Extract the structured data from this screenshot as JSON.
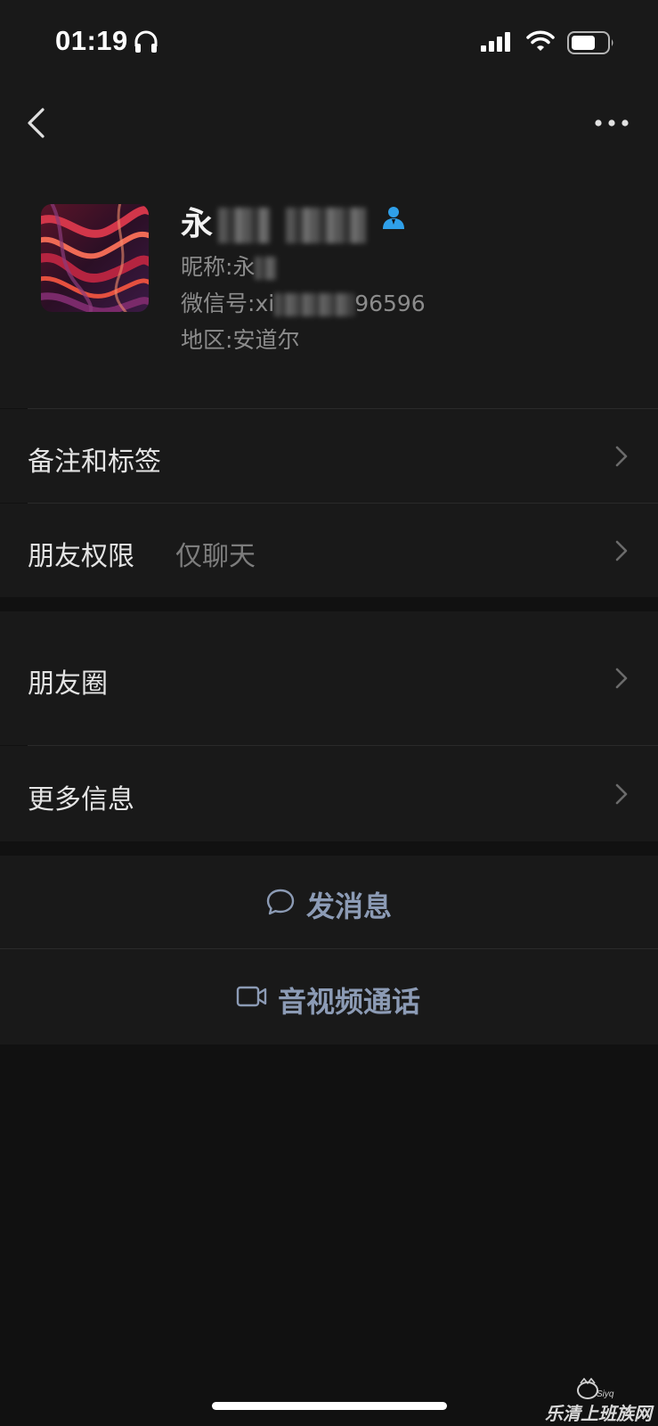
{
  "status_bar": {
    "time": "01:19"
  },
  "profile": {
    "name_first_char": "永",
    "nickname_label": "昵称:",
    "nickname_value": "永",
    "wechat_id_label": "微信号:",
    "wechat_id_visible_start": "xi",
    "wechat_id_visible_end": "96596",
    "region_label": "地区:",
    "region_value": "安道尔"
  },
  "rows": {
    "remarks_tags": "备注和标签",
    "friend_permissions": "朋友权限",
    "friend_permissions_value": "仅聊天",
    "moments": "朋友圈",
    "more_info": "更多信息"
  },
  "actions": {
    "send_message": "发消息",
    "video_call": "音视频通话"
  },
  "watermark": {
    "text": "乐清上班族网"
  },
  "colors": {
    "background": "#111111",
    "surface": "#191919",
    "action_text": "#8c9bb5",
    "contact_icon": "#2f9fe8"
  }
}
